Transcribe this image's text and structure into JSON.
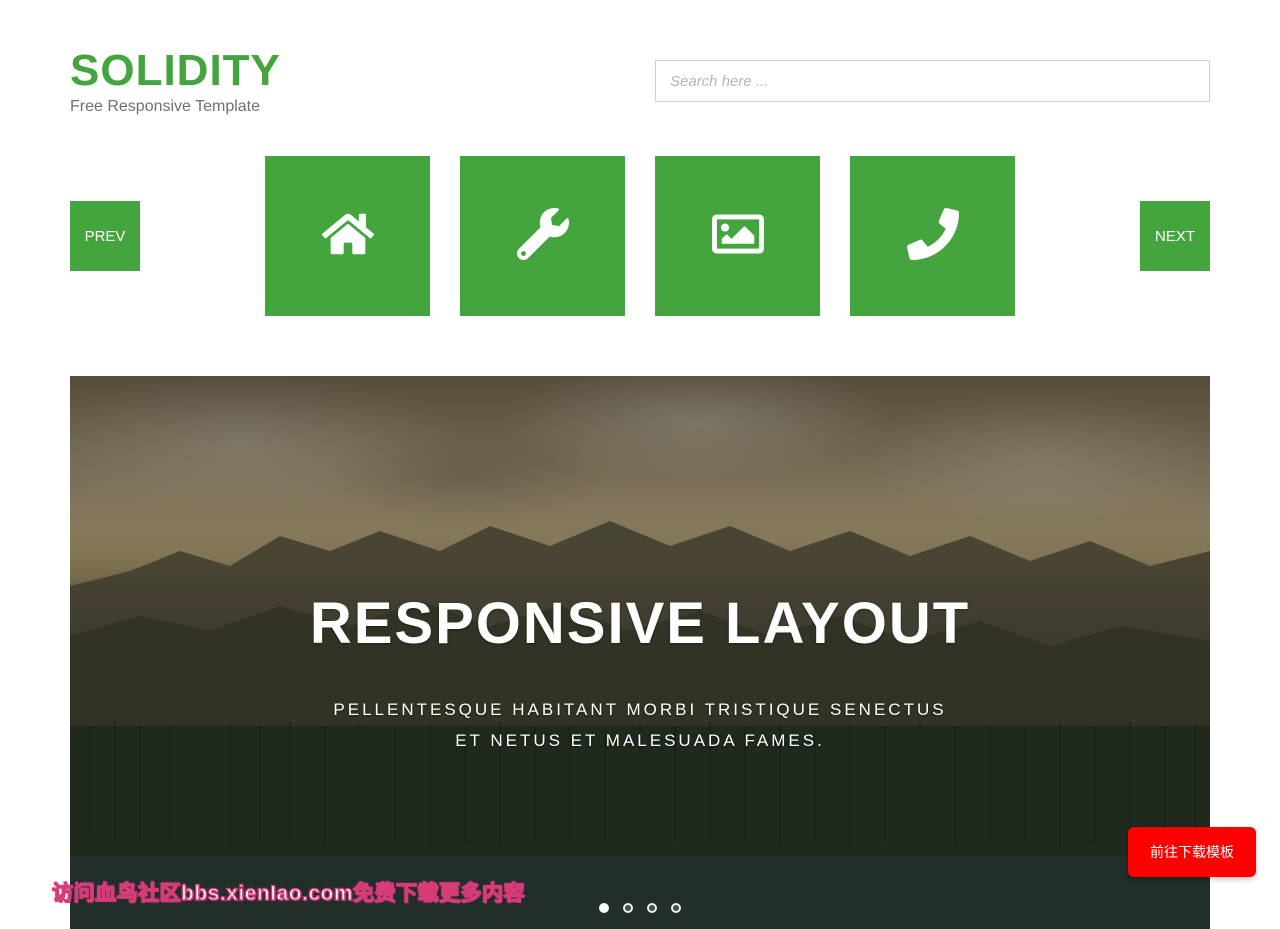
{
  "brand": {
    "title": "SOLIDITY",
    "subtitle": "Free Responsive Template"
  },
  "search": {
    "placeholder": "Search here ..."
  },
  "nav": {
    "prev": "PREV",
    "next": "NEXT",
    "tiles": [
      {
        "icon": "home"
      },
      {
        "icon": "wrench"
      },
      {
        "icon": "image"
      },
      {
        "icon": "phone"
      }
    ]
  },
  "hero": {
    "title": "RESPONSIVE LAYOUT",
    "line1": "PELLENTESQUE HABITANT MORBI TRISTIQUE SENECTUS",
    "line2": "ET NETUS ET MALESUADA FAMES.",
    "dots": 4,
    "activeDot": 0
  },
  "float_button": "前往下载模板",
  "watermark": "访问血鸟社区bbs.xienIao.com免费下载更多内容",
  "colors": {
    "primary": "#44a43d",
    "danger": "#ff0000"
  }
}
